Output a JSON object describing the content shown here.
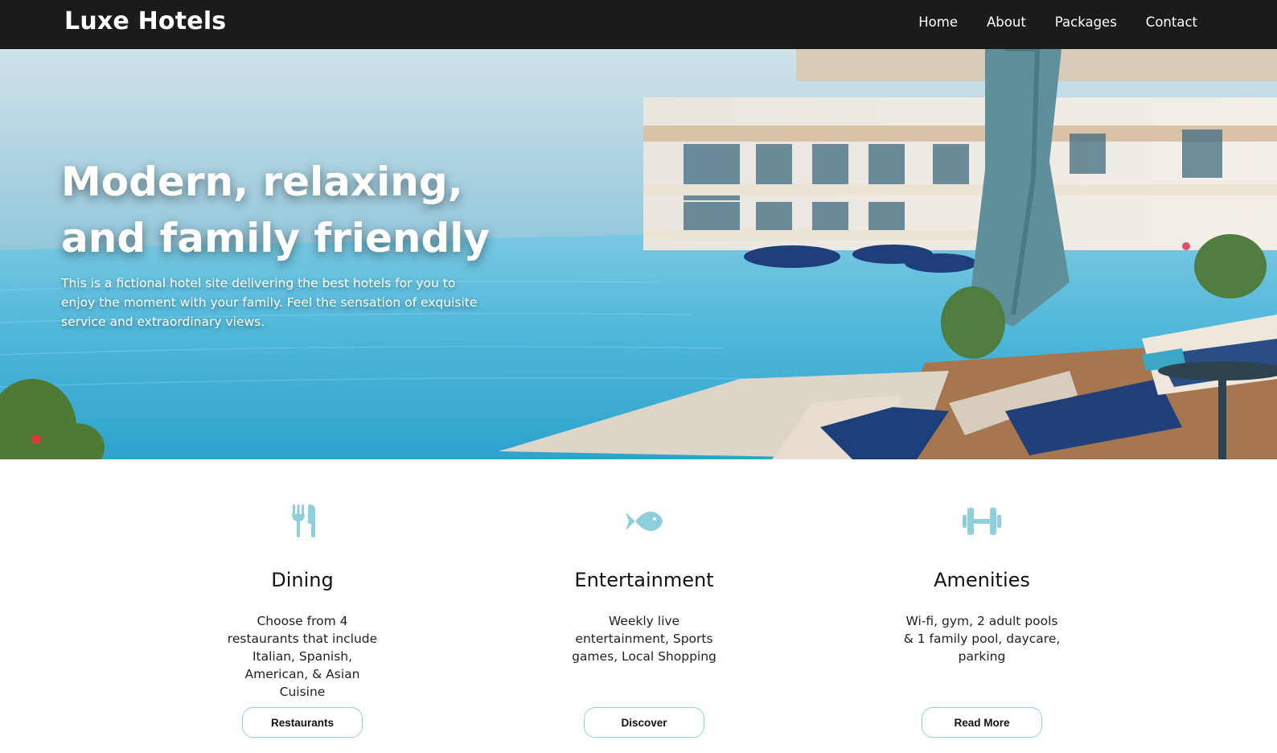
{
  "brand": "Luxe Hotels",
  "nav": {
    "home": "Home",
    "about": "About",
    "packages": "Packages",
    "contact": "Contact"
  },
  "hero": {
    "title_line1": "Modern, relaxing,",
    "title_line2": "and family friendly",
    "description": "This is a fictional hotel site delivering the best hotels for you to enjoy the moment with your family. Feel the sensation of exquisite service and extraordinary views."
  },
  "features": [
    {
      "icon": "utensils-icon",
      "title": "Dining",
      "text": "Choose from 4 restaurants that include Italian, Spanish, American, & Asian Cuisine",
      "button": "Restaurants"
    },
    {
      "icon": "fish-icon",
      "title": "Entertainment",
      "text": "Weekly live entertainment, Sports games, Local Shopping",
      "button": "Discover"
    },
    {
      "icon": "dumbbell-icon",
      "title": "Amenities",
      "text": "Wi-fi, gym, 2 adult pools & 1 family pool, daycare, parking",
      "button": "Read More"
    }
  ],
  "colors": {
    "navbar_bg": "#1b1b1b",
    "accent": "#8fd1e0",
    "icon_color": "#8fcfdc"
  }
}
